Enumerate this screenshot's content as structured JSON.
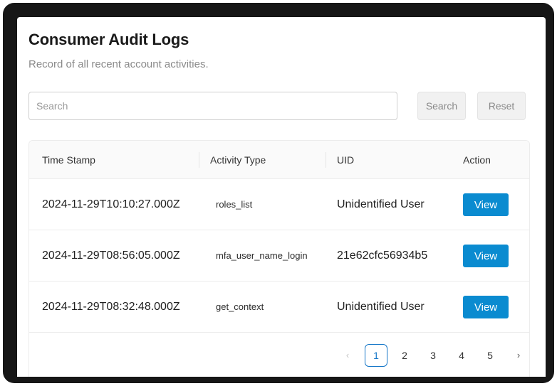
{
  "header": {
    "title": "Consumer Audit Logs",
    "subtitle": "Record of all recent account activities."
  },
  "search": {
    "placeholder": "Search",
    "value": "",
    "search_label": "Search",
    "reset_label": "Reset"
  },
  "table": {
    "columns": [
      "Time Stamp",
      "Activity Type",
      "UID",
      "Action"
    ],
    "rows": [
      {
        "timestamp": "2024-11-29T10:10:27.000Z",
        "activity": "roles_list",
        "uid": "Unidentified User",
        "action": "View"
      },
      {
        "timestamp": "2024-11-29T08:56:05.000Z",
        "activity": "mfa_user_name_login",
        "uid": "21e62cfc56934b5",
        "action": "View"
      },
      {
        "timestamp": "2024-11-29T08:32:48.000Z",
        "activity": "get_context",
        "uid": "Unidentified User",
        "action": "View"
      }
    ]
  },
  "pagination": {
    "prev": "‹",
    "next": "›",
    "pages": [
      "1",
      "2",
      "3",
      "4",
      "5"
    ],
    "current": "1"
  },
  "colors": {
    "primary": "#0a8bd0",
    "active_page": "#1677c8",
    "frame": "#161616"
  },
  "icons": {
    "prev": "chevron-left-icon",
    "next": "chevron-right-icon"
  }
}
